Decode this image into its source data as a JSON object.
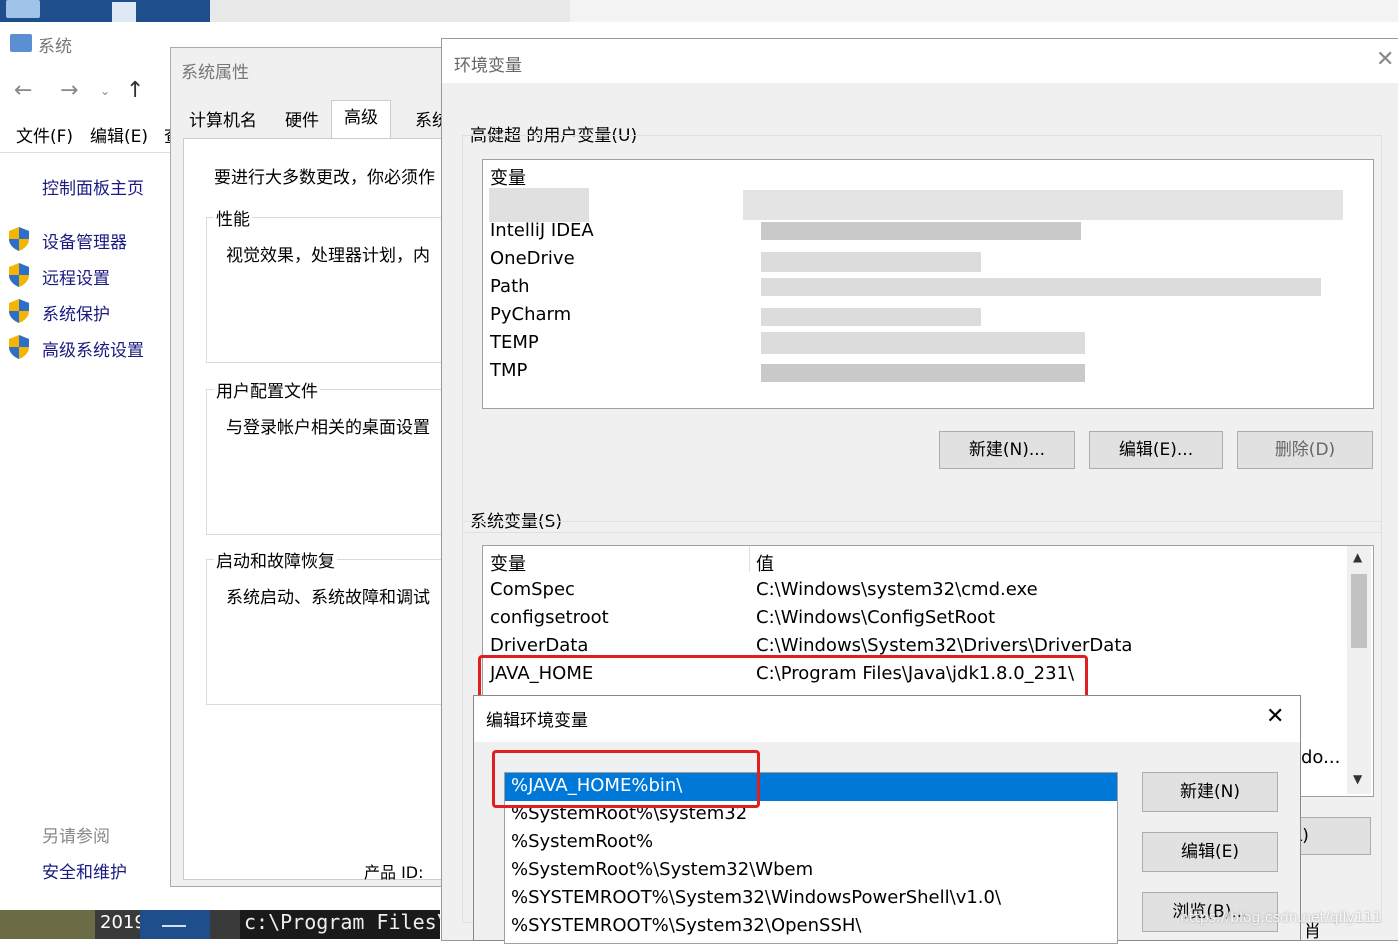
{
  "system_window": {
    "title": "系统",
    "menu": {
      "file": "文件(F)",
      "edit": "编辑(E)",
      "view_partial": "查"
    },
    "control_panel_home": "控制面板主页",
    "links": [
      {
        "label": "设备管理器",
        "icon": "shield-icon"
      },
      {
        "label": "远程设置",
        "icon": "shield-icon"
      },
      {
        "label": "系统保护",
        "icon": "shield-icon"
      },
      {
        "label": "高级系统设置",
        "icon": "shield-icon"
      }
    ],
    "see_also": "另请参阅",
    "security_link": "安全和维护"
  },
  "taskbar": {
    "year_partial": "2019",
    "cmd_text": "c:\\Program Files\\",
    "product_id_partial": "产品 ID:"
  },
  "sys_props": {
    "title": "系统属性",
    "tabs": [
      "计算机名",
      "硬件",
      "高级",
      "系统"
    ],
    "active_tab": "高级",
    "intro": "要进行大多数更改，你必须作",
    "groups": [
      {
        "title": "性能",
        "desc": "视觉效果，处理器计划，内"
      },
      {
        "title": "用户配置文件",
        "desc": "与登录帐户相关的桌面设置"
      },
      {
        "title": "启动和故障恢复",
        "desc": "系统启动、系统故障和调试"
      }
    ]
  },
  "env_window": {
    "title": "环境变量",
    "user_section": "高健超 的用户变量(U)",
    "user_header_var": "变量",
    "user_vars": [
      "IntelliJ IDEA",
      "OneDrive",
      "Path",
      "PyCharm",
      "TEMP",
      "TMP"
    ],
    "user_buttons": {
      "new": "新建(N)...",
      "edit": "编辑(E)...",
      "delete": "删除(D)"
    },
    "system_section": "系统变量(S)",
    "system_header": {
      "var": "变量",
      "val": "值"
    },
    "system_vars": [
      {
        "name": "ComSpec",
        "value": "C:\\Windows\\system32\\cmd.exe"
      },
      {
        "name": "configsetroot",
        "value": "C:\\Windows\\ConfigSetRoot"
      },
      {
        "name": "DriverData",
        "value": "C:\\Windows\\System32\\Drivers\\DriverData"
      },
      {
        "name": "JAVA_HOME",
        "value": "C:\\Program Files\\Java\\jdk1.8.0_231\\"
      }
    ],
    "partial_right": "do...",
    "delete_partial": "除(L)",
    "bottom_partial": "肖"
  },
  "edit_dialog": {
    "title": "编辑环境变量",
    "entries": [
      "%JAVA_HOME%bin\\",
      "%SystemRoot%\\system32",
      "%SystemRoot%",
      "%SystemRoot%\\System32\\Wbem",
      "%SYSTEMROOT%\\System32\\WindowsPowerShell\\v1.0\\",
      "%SYSTEMROOT%\\System32\\OpenSSH\\"
    ],
    "selected_index": 0,
    "buttons": {
      "new": "新建(N)",
      "edit": "编辑(E)",
      "browse": "浏览(B)..."
    }
  },
  "watermark": "https://blog.csdn.net/qily111",
  "colors": {
    "selection": "#0078d7",
    "highlight_box": "#e02020",
    "link": "#1a1a80"
  }
}
